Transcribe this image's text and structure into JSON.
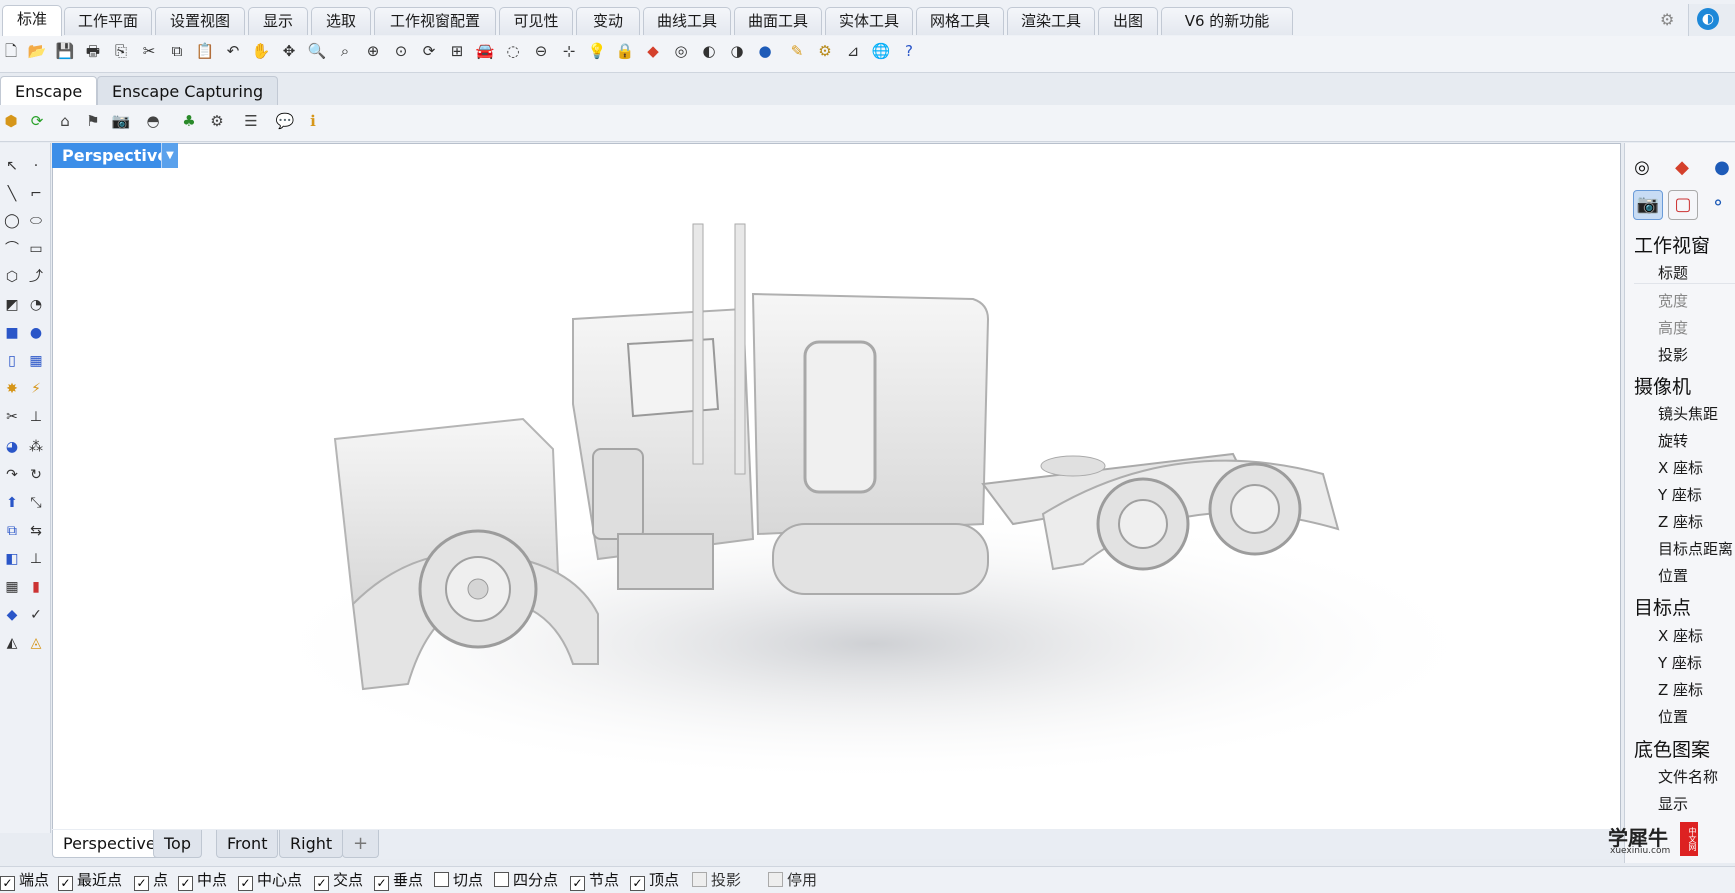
{
  "main_tabs": [
    "标准",
    "工作平面",
    "设置视图",
    "显示",
    "选取",
    "工作视窗配置",
    "可见性",
    "变动",
    "曲线工具",
    "曲面工具",
    "实体工具",
    "网格工具",
    "渲染工具",
    "出图",
    "V6 的新功能"
  ],
  "plugin_tabs": [
    "Enscape",
    "Enscape Capturing"
  ],
  "toolbar_icons": [
    "new-icon",
    "open-icon",
    "save-icon",
    "print-icon",
    "import-icon",
    "cut-icon",
    "copy-icon",
    "paste-icon",
    "undo-icon",
    "pan-icon",
    "move-icon",
    "zoom-icon",
    "zoom-window-icon",
    "zoom-extents-icon",
    "zoom-selected-icon",
    "rotate-view-icon",
    "four-views-icon",
    "car-icon",
    "hide-icon",
    "cplane-icon",
    "snap-icon",
    "light-icon",
    "lock-icon",
    "layer-icon",
    "color-wheel-icon",
    "material-icon",
    "render-icon",
    "sphere-icon",
    "paint-icon",
    "settings-gear-icon",
    "dimension-icon",
    "globe-icon",
    "help-icon"
  ],
  "enscape_icons": [
    "enscape-start-icon",
    "enscape-sync-icon",
    "enscape-view-icon",
    "enscape-asset-icon",
    "enscape-screenshot-icon",
    "enscape-vr-icon",
    "enscape-tree-icon",
    "enscape-batch-icon",
    "enscape-settings-icon",
    "enscape-feedback-icon",
    "enscape-about-icon"
  ],
  "viewport": {
    "title": "Perspective"
  },
  "view_tabs": [
    "Perspective",
    "Top",
    "Front",
    "Right"
  ],
  "osnaps": [
    {
      "label": "端点",
      "checked": true
    },
    {
      "label": "最近点",
      "checked": true
    },
    {
      "label": "点",
      "checked": true
    },
    {
      "label": "中点",
      "checked": true
    },
    {
      "label": "中心点",
      "checked": true
    },
    {
      "label": "交点",
      "checked": true
    },
    {
      "label": "垂点",
      "checked": true
    },
    {
      "label": "切点",
      "checked": false
    },
    {
      "label": "四分点",
      "checked": false
    },
    {
      "label": "节点",
      "checked": true
    },
    {
      "label": "顶点",
      "checked": true
    },
    {
      "label": "投影",
      "checked": false
    },
    {
      "label": "停用",
      "checked": false
    }
  ],
  "properties": {
    "sections": [
      {
        "title": "工作视窗",
        "items": [
          "标题",
          "宽度",
          "高度",
          "投影"
        ]
      },
      {
        "title": "摄像机",
        "items": [
          "镜头焦距",
          "旋转",
          "X 座标",
          "Y 座标",
          "Z 座标",
          "目标点距离",
          "位置"
        ]
      },
      {
        "title": "目标点",
        "items": [
          "X 座标",
          "Y 座标",
          "Z 座标",
          "位置"
        ]
      },
      {
        "title": "底色图案",
        "items": [
          "文件名称",
          "显示"
        ]
      }
    ]
  },
  "watermark": {
    "brand": "学犀牛",
    "url": "xuexiniu.com",
    "badge": "中文网"
  }
}
